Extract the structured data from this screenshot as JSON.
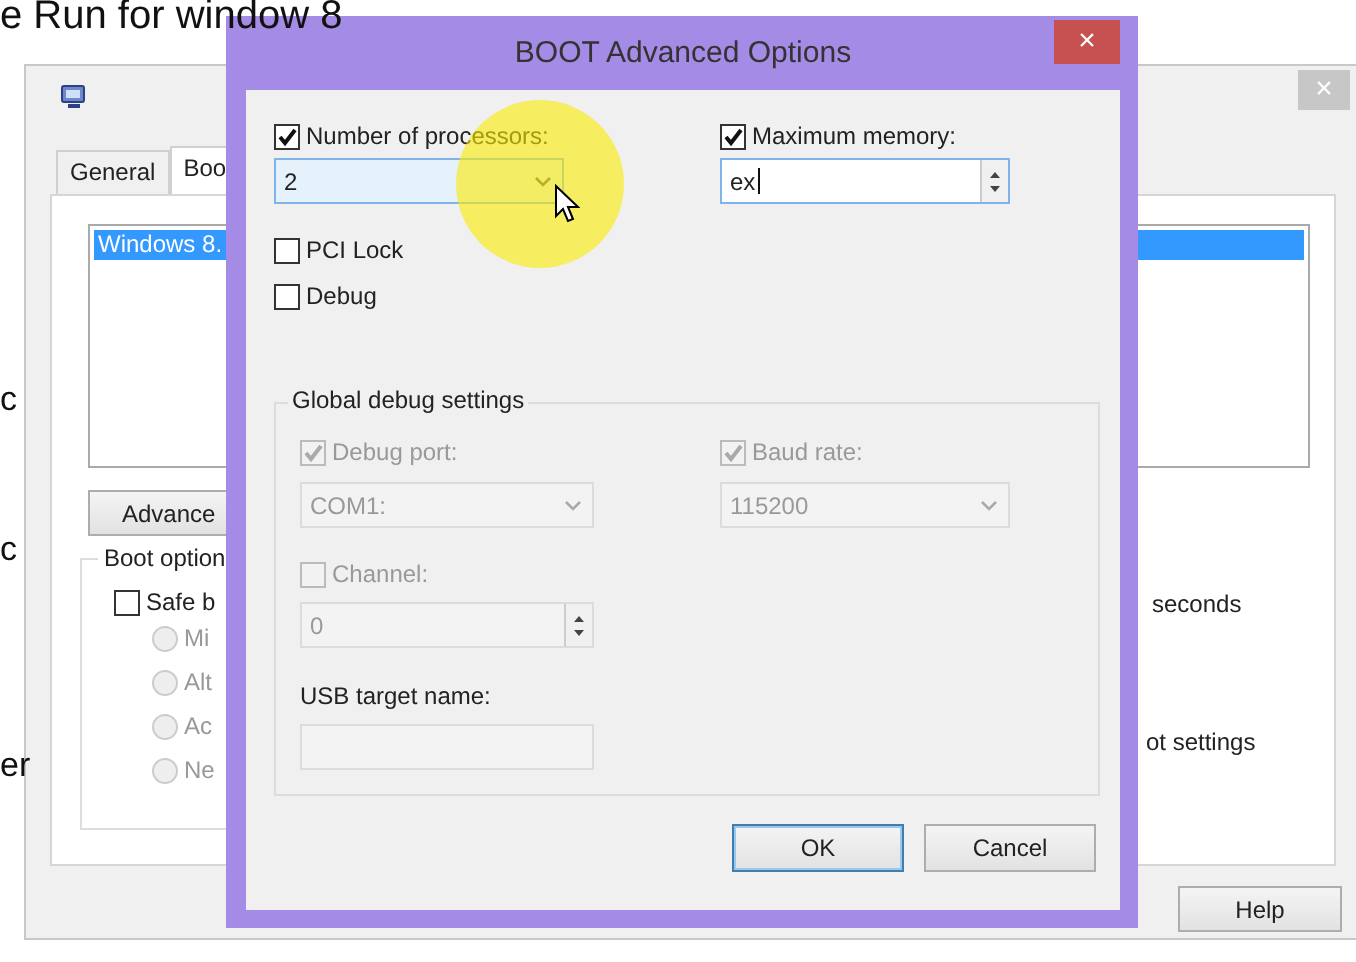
{
  "page_text": "e Run for window 8",
  "side_fragments": [
    "c",
    "c",
    "er"
  ],
  "background_window": {
    "close": "×",
    "tabs": [
      {
        "label": "General",
        "selected": false
      },
      {
        "label": "Boo",
        "selected": true
      }
    ],
    "boot_list": [
      {
        "label": "Windows 8.",
        "selected": true
      }
    ],
    "advanced_button": "Advance",
    "boot_options": {
      "title": "Boot option",
      "safe_boot": {
        "label": "Safe b",
        "checked": false
      },
      "radios": [
        {
          "label": "Mi",
          "selected": false,
          "disabled": true
        },
        {
          "label": "Alt",
          "selected": false,
          "disabled": true
        },
        {
          "label": "Ac",
          "selected": false,
          "disabled": true
        },
        {
          "label": "Ne",
          "selected": false,
          "disabled": true
        }
      ]
    },
    "timeout_unit": "seconds",
    "make_permanent": "ot settings",
    "help_button": "Help"
  },
  "dialog": {
    "title": "BOOT Advanced Options",
    "close": "×",
    "number_of_processors": {
      "label": "Number of processors:",
      "checked": true,
      "value": "2"
    },
    "maximum_memory": {
      "label": "Maximum memory:",
      "checked": true,
      "value": "ex"
    },
    "pci_lock": {
      "label": "PCI Lock",
      "checked": false
    },
    "debug": {
      "label": "Debug",
      "checked": false
    },
    "global_debug": {
      "title": "Global debug settings",
      "debug_port": {
        "label": "Debug port:",
        "checked": true,
        "disabled": true,
        "value": "COM1:"
      },
      "baud_rate": {
        "label": "Baud rate:",
        "checked": true,
        "disabled": true,
        "value": "115200"
      },
      "channel": {
        "label": "Channel:",
        "checked": false,
        "disabled": true,
        "value": "0"
      },
      "usb_target_name": {
        "label": "USB target name:",
        "disabled": true
      }
    },
    "buttons": [
      {
        "label": "OK",
        "default": true
      },
      {
        "label": "Cancel",
        "default": false
      }
    ]
  }
}
